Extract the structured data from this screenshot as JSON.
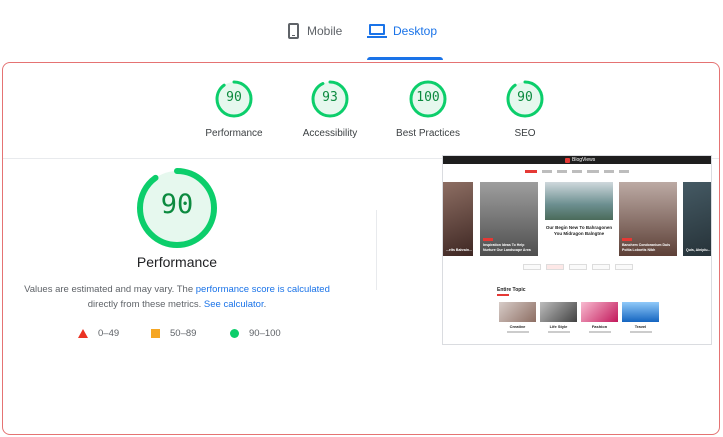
{
  "tabs": {
    "mobile": {
      "label": "Mobile",
      "icon": "phone-icon"
    },
    "desktop": {
      "label": "Desktop",
      "icon": "laptop-icon",
      "selected": true
    }
  },
  "summary": [
    {
      "label": "Performance",
      "score": "90"
    },
    {
      "label": "Accessibility",
      "score": "93"
    },
    {
      "label": "Best Practices",
      "score": "100"
    },
    {
      "label": "SEO",
      "score": "90"
    }
  ],
  "performance": {
    "score": "90",
    "score_fraction": 0.9,
    "title": "Performance",
    "desc_prefix": "Values are estimated and may vary. The ",
    "desc_link1": "performance score is calculated",
    "desc_middle": " directly from these metrics. ",
    "desc_link2": "See calculator",
    "desc_suffix": "."
  },
  "legend": [
    {
      "range": "0–49",
      "shape": "triangle",
      "color": "#eb3323"
    },
    {
      "range": "50–89",
      "shape": "square",
      "color": "#f5a623"
    },
    {
      "range": "90–100",
      "shape": "circle",
      "color": "#0cce6b"
    }
  ],
  "colors": {
    "pass_green": "#0cce6b",
    "pass_text": "#0c8a3f",
    "pass_fill": "#e6f8ee",
    "accent_blue": "#1a73e8",
    "card_border": "#e57373"
  },
  "screenshot": {
    "logo": "BlogViews",
    "slides": [
      {
        "caption": "...elts Bahrain..."
      },
      {
        "caption": "Inspiration Ideas To Help Nurture Our Landscape Area"
      },
      {
        "caption": "Our Begin New To Bahragonen You Midragon Balngtne"
      },
      {
        "caption": "Banchem Condoranium Duis Poltia Lobortis Nibh"
      },
      {
        "caption": "Quis, Ainiplu..."
      }
    ],
    "section_title": "Entire Topic",
    "topics": [
      {
        "label": "Creative"
      },
      {
        "label": "Life Style"
      },
      {
        "label": "Fashion"
      },
      {
        "label": "Travel"
      }
    ]
  }
}
